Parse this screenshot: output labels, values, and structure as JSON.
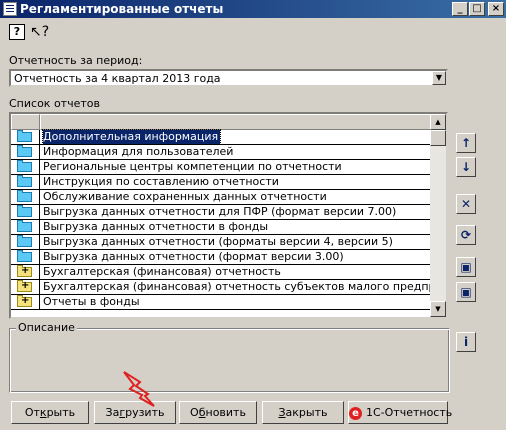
{
  "window": {
    "title": "Регламентированные отчеты",
    "controls": {
      "minimize": "_",
      "maximize": "□",
      "close": "×"
    }
  },
  "toolbar": {
    "help": "?",
    "whats_this": "↖?"
  },
  "period": {
    "label": "Отчетность за период:",
    "value": "Отчетность за 4 квартал 2013 года"
  },
  "reports": {
    "label": "Список отчетов",
    "items": [
      {
        "text": "Дополнительная информация",
        "icon": "folder-icon",
        "selected": true
      },
      {
        "text": "Информация для пользователей",
        "icon": "folder-icon"
      },
      {
        "text": "Региональные центры компетенции по отчетности",
        "icon": "folder-icon"
      },
      {
        "text": "Инструкция по составлению отчетности",
        "icon": "folder-icon"
      },
      {
        "text": "Обслуживание сохраненных данных отчетности",
        "icon": "folder-icon"
      },
      {
        "text": "Выгрузка данных отчетности для ПФР (формат версии 7.00)",
        "icon": "folder-icon"
      },
      {
        "text": "Выгрузка данных отчетности в фонды",
        "icon": "folder-icon"
      },
      {
        "text": "Выгрузка данных отчетности (форматы версии 4, версии 5)",
        "icon": "folder-icon"
      },
      {
        "text": "Выгрузка данных отчетности (формат версии 3.00)",
        "icon": "folder-icon"
      },
      {
        "text": "Бухгалтерская (финансовая) отчетность",
        "icon": "folder-plus-icon"
      },
      {
        "text": "Бухгалтерская (финансовая) отчетность субъектов малого предпринимател",
        "icon": "folder-plus-icon"
      },
      {
        "text": "Отчеты в фонды",
        "icon": "folder-plus-icon"
      }
    ]
  },
  "side_buttons": {
    "up": "↑",
    "down": "↓",
    "delete": "✕",
    "refresh": "⟳",
    "import": "▣",
    "export": "▣",
    "info": "i"
  },
  "description": {
    "label": "Описание"
  },
  "buttons": {
    "open_pre": "От",
    "open_u": "к",
    "open_post": "рыть",
    "load_pre": "За",
    "load_u": "г",
    "load_post": "рузить",
    "update_pre": "О",
    "update_u": "б",
    "update_post": "новить",
    "close_pre": "",
    "close_u": "З",
    "close_post": "акрыть",
    "otchetnost": "1С-Отчетность",
    "otchetnost_logo": "e"
  },
  "colors": {
    "selection": "#0a246a",
    "folder": "#5bc8f5",
    "folder_plus": "#f5e27a",
    "marker": "#e02020"
  }
}
